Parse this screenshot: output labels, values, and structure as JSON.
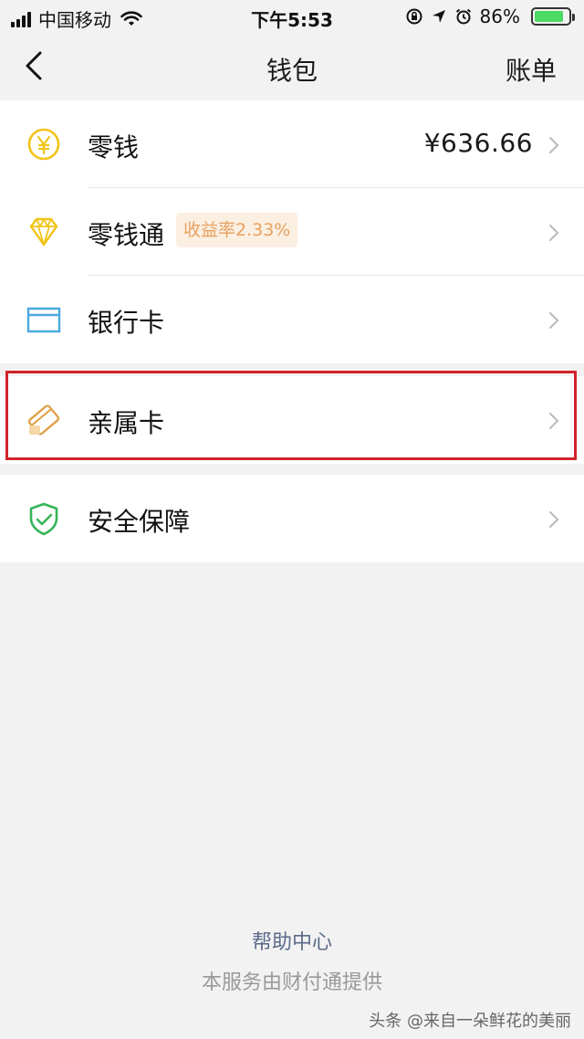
{
  "status_bar": {
    "carrier": "中国移动",
    "time": "下午5:53",
    "battery": "86%",
    "battery_level": 0.86
  },
  "nav": {
    "title": "钱包",
    "right_label": "账单"
  },
  "wallet_items": [
    {
      "label": "零钱",
      "value": "¥636.66",
      "icon": "yuan-coin-icon"
    },
    {
      "label": "零钱通",
      "badge": "收益率2.33%",
      "icon": "diamond-icon"
    },
    {
      "label": "银行卡",
      "icon": "bank-card-icon"
    },
    {
      "label": "亲属卡",
      "icon": "family-card-icon"
    },
    {
      "label": "安全保障",
      "icon": "shield-check-icon"
    }
  ],
  "footer": {
    "help_link": "帮助中心",
    "provider_note": "本服务由财付通提供"
  },
  "watermark": "头条 @来自一朵鲜花的美丽",
  "colors": {
    "background": "#f2f2f2",
    "highlight": "#d1232b",
    "badge_bg": "#fbefe2",
    "badge_text": "#e8a15e",
    "link": "#5b6b8a",
    "shield": "#35b558",
    "bank_card": "#4aa8e0",
    "coin": "#f0c419",
    "family_card": "#e0a24a"
  }
}
